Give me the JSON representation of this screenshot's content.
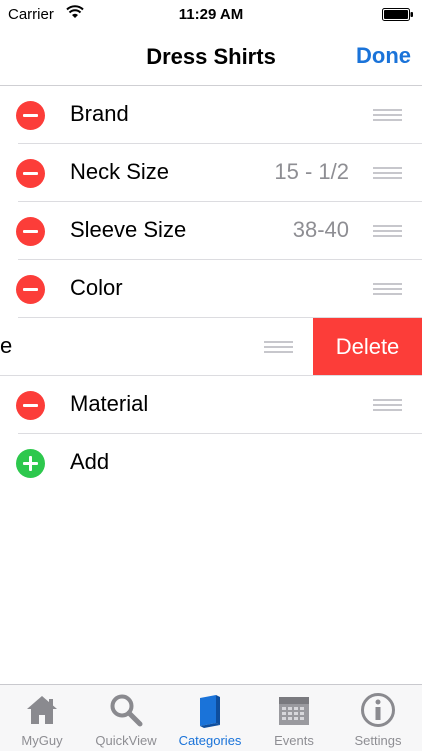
{
  "status_bar": {
    "carrier": "Carrier",
    "time": "11:29 AM"
  },
  "nav": {
    "title": "Dress Shirts",
    "done_label": "Done"
  },
  "rows": [
    {
      "label": "Brand",
      "value": ""
    },
    {
      "label": "Neck Size",
      "value": "15 - 1/2"
    },
    {
      "label": "Sleeve Size",
      "value": "38-40"
    },
    {
      "label": "Color",
      "value": ""
    },
    {
      "label": "e",
      "value": ""
    },
    {
      "label": "Material",
      "value": ""
    }
  ],
  "delete_label": "Delete",
  "add_label": "Add",
  "tabs": [
    {
      "label": "MyGuy",
      "icon": "house-icon"
    },
    {
      "label": "QuickView",
      "icon": "magnifier-icon"
    },
    {
      "label": "Categories",
      "icon": "book-icon",
      "active": true
    },
    {
      "label": "Events",
      "icon": "calendar-icon"
    },
    {
      "label": "Settings",
      "icon": "info-icon"
    }
  ],
  "colors": {
    "accent": "#1a73d9",
    "delete": "#fc3d39",
    "add": "#2dc84d"
  }
}
